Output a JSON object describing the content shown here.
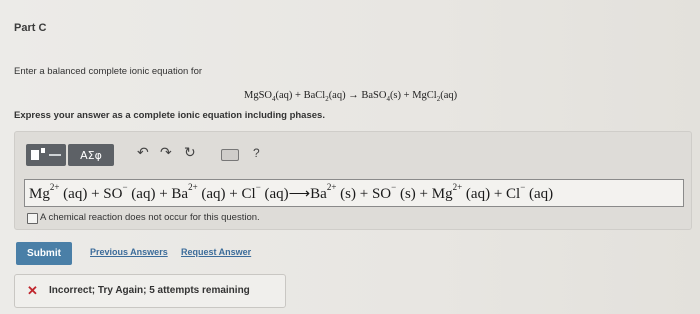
{
  "part": {
    "title": "Part C"
  },
  "question": {
    "instruction": "Enter a balanced complete ionic equation for",
    "reaction": {
      "r1": "MgSO",
      "r1_sub": "4",
      "r1_state": "(aq) + BaCl",
      "r2_sub": "2",
      "r2_state": "(aq)",
      "arrow": "→",
      "p1": "BaSO",
      "p1_sub": "4",
      "p1_state": "(s) + MgCl",
      "p2_sub": "2",
      "p2_state": "(aq)"
    },
    "express": "Express your answer as a complete ionic equation including phases."
  },
  "toolbar": {
    "greek_label": "ΑΣφ",
    "undo_icon": "undo-icon",
    "redo_icon": "redo-icon",
    "reset_icon": "reset-icon",
    "keyboard_icon": "keyboard-icon",
    "help_label": "?"
  },
  "answer": {
    "equation": {
      "t1": "Mg",
      "t1_sup": "2+",
      "t2": "(aq) + SO",
      "t2_sup": "−",
      "t3": "(aq) + Ba",
      "t3_sup": "2+",
      "t4": "(aq) + Cl",
      "t4_sup": "−",
      "t5": "(aq)⟶Ba",
      "t5_sup": "2+",
      "t6": "(s) + SO",
      "t6_sup": "−",
      "t7": "(s) + Mg",
      "t7_sup": "2+",
      "t8": "(aq) + Cl",
      "t8_sup": "−",
      "t9": "(aq)"
    },
    "no_reaction_label": "A chemical reaction does not occur for this question."
  },
  "actions": {
    "submit_label": "Submit",
    "previous_answers_label": "Previous Answers",
    "request_answer_label": "Request Answer"
  },
  "feedback": {
    "icon": "x-icon",
    "text": "Incorrect; Try Again; 5 attempts remaining",
    "color": "#c0262d"
  }
}
